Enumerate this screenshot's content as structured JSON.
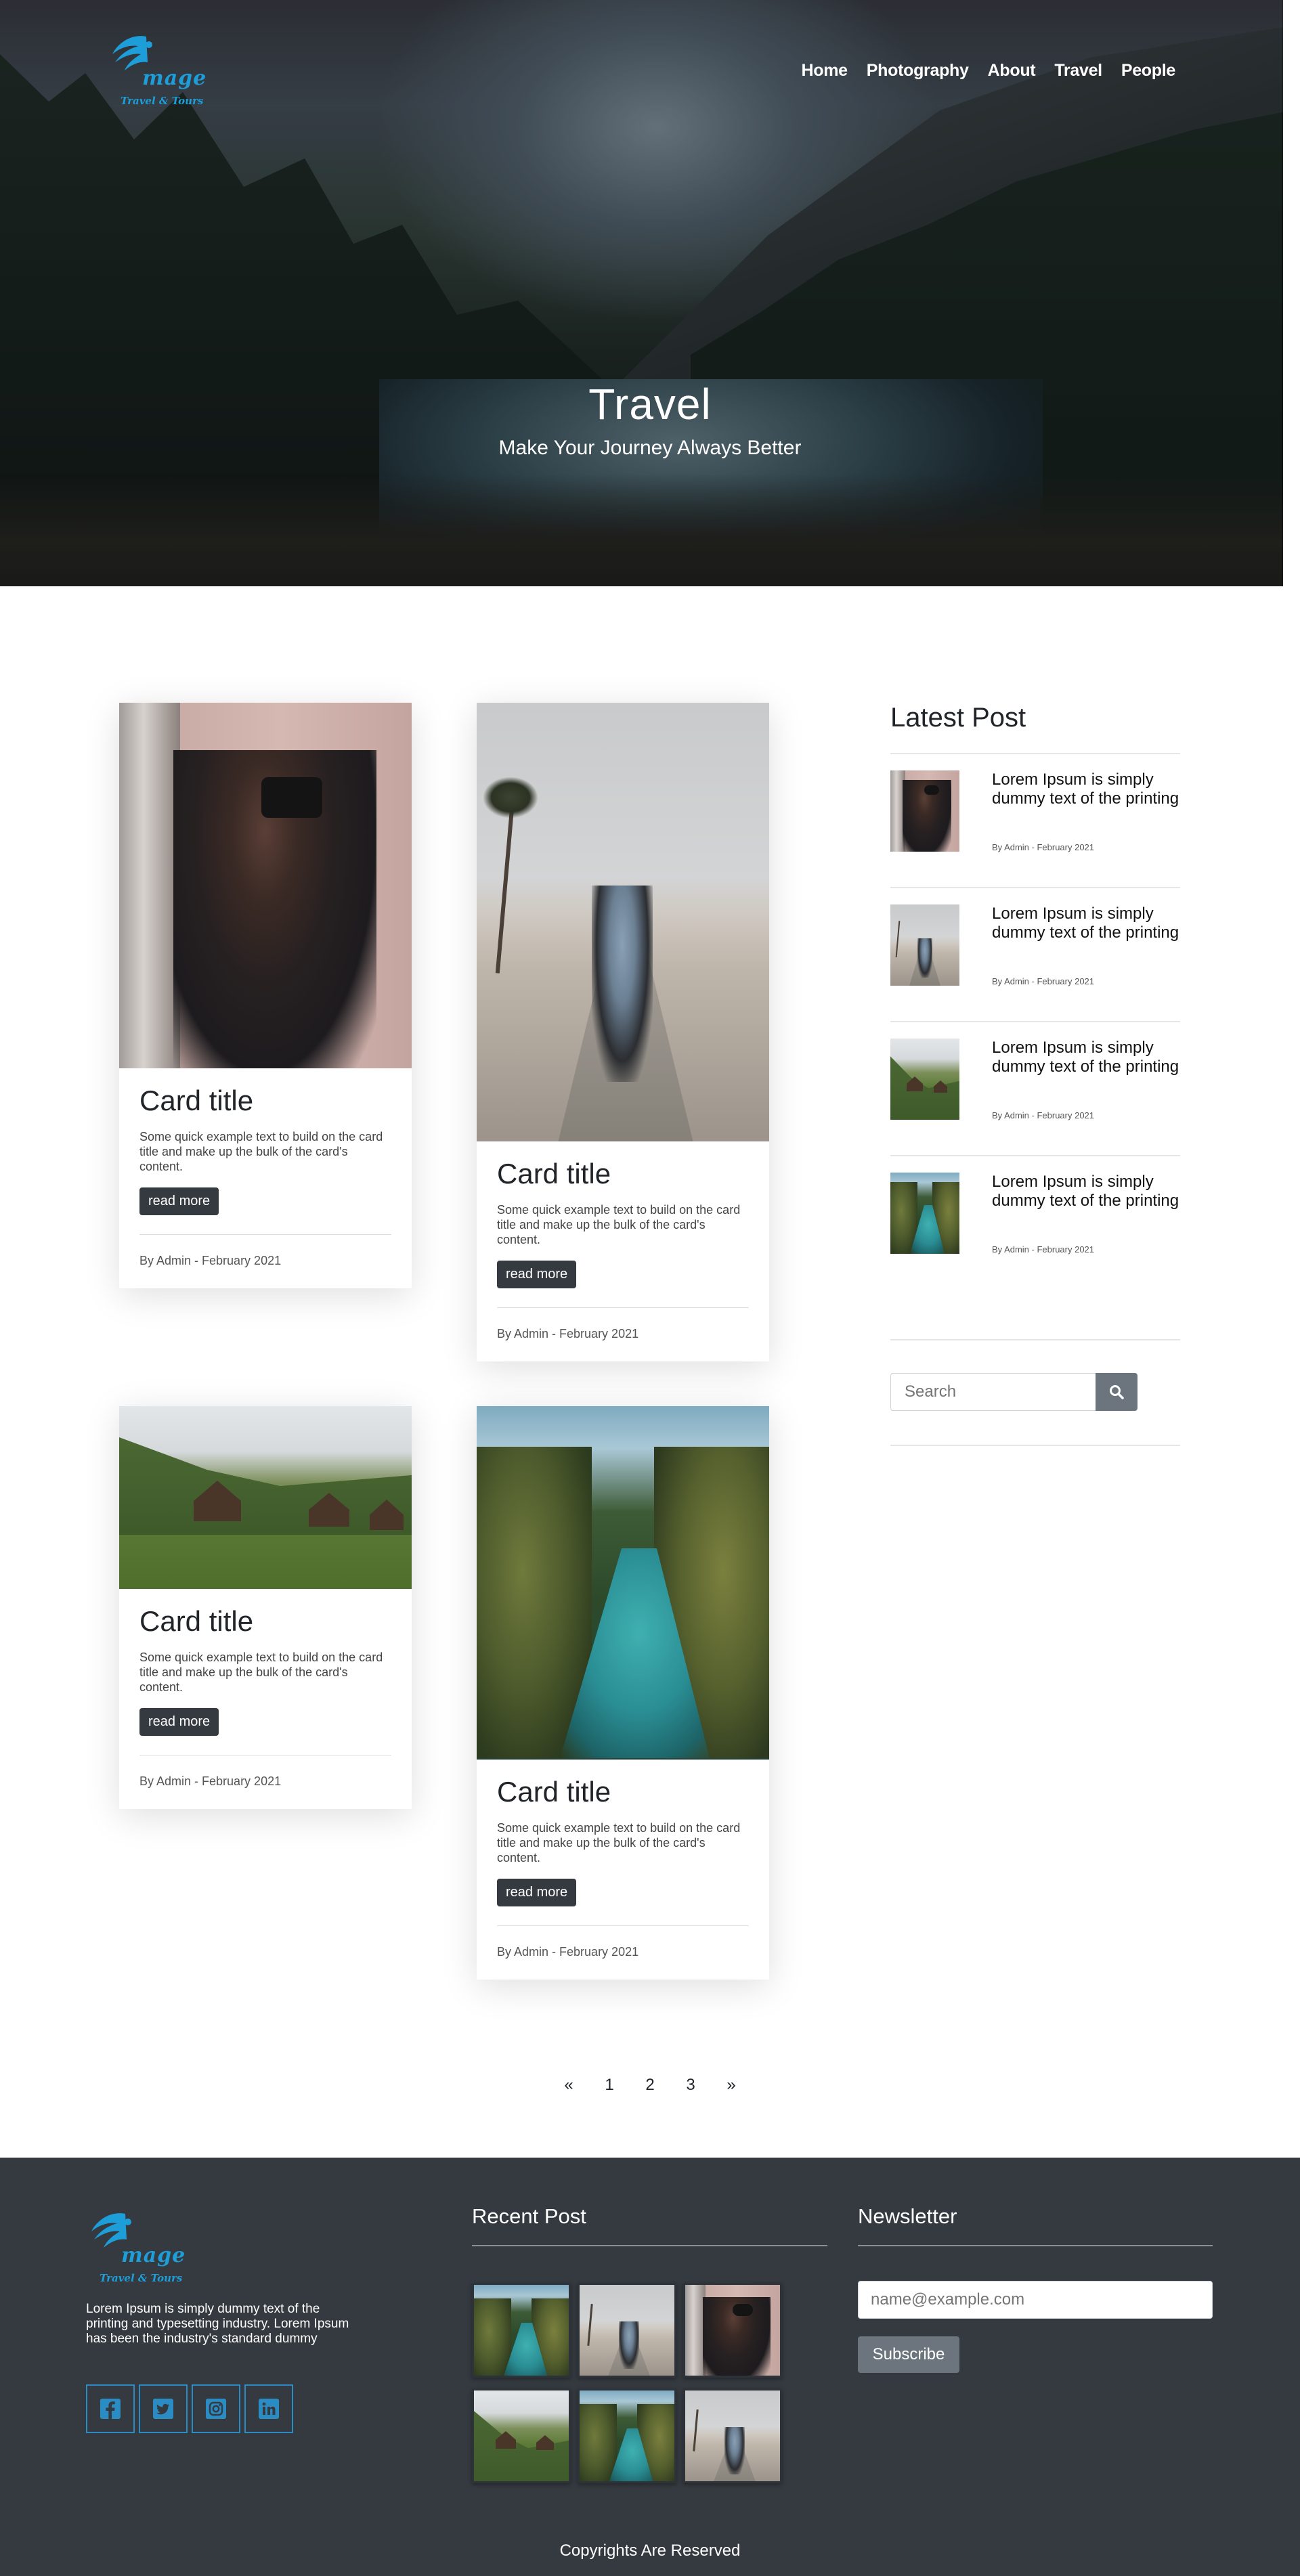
{
  "header": {
    "logo": {
      "name": "mage",
      "tagline": "Travel & Tours"
    },
    "nav": [
      "Home",
      "Photography",
      "About",
      "Travel",
      "People"
    ]
  },
  "hero": {
    "title": "Travel",
    "subtitle": "Make Your Journey Always Better"
  },
  "cards": [
    {
      "image": "photographer-photo",
      "title": "Card title",
      "text": "Some quick example text to build on the card title and make up the bulk of the card's content.",
      "button": "read more",
      "meta": "By Admin - February 2021"
    },
    {
      "image": "skateboarder-photo",
      "title": "Card title",
      "text": "Some quick example text to build on the card title and make up the bulk of the card's content.",
      "button": "read more",
      "meta": "By Admin - February 2021"
    },
    {
      "image": "cabins-photo",
      "title": "Card title",
      "text": "Some quick example text to build on the card title and make up the bulk of the card's content.",
      "button": "read more",
      "meta": "By Admin - February 2021"
    },
    {
      "image": "tropical-river-photo",
      "title": "Card title",
      "text": "Some quick example text to build on the card title and make up the bulk of the card's content.",
      "button": "read more",
      "meta": "By Admin - February 2021"
    }
  ],
  "sidebar": {
    "latest_title": "Latest Post",
    "posts": [
      {
        "image": "photographer-photo",
        "title": "Lorem Ipsum is simply dummy text of the printing",
        "meta": "By Admin - February 2021"
      },
      {
        "image": "skateboarder-photo",
        "title": "Lorem Ipsum is simply dummy text of the printing",
        "meta": "By Admin - February 2021"
      },
      {
        "image": "cabins-photo",
        "title": "Lorem Ipsum is simply dummy text of the printing",
        "meta": "By Admin - February 2021"
      },
      {
        "image": "tropical-river-photo",
        "title": "Lorem Ipsum is simply dummy text of the printing",
        "meta": "By Admin - February 2021"
      }
    ],
    "search": {
      "placeholder": "Search",
      "icon": "search-icon"
    }
  },
  "pagination": {
    "prev": "«",
    "pages": [
      "1",
      "2",
      "3"
    ],
    "next": "»"
  },
  "footer": {
    "about": "Lorem Ipsum is simply dummy text of the printing and typesetting industry. Lorem Ipsum has been the industry's standard dummy",
    "socials": [
      "facebook-icon",
      "twitter-icon",
      "instagram-icon",
      "linkedin-icon"
    ],
    "recent_title": "Recent Post",
    "gallery": [
      "tropical-river-photo",
      "skateboarder-photo",
      "photographer-photo",
      "cabins-photo",
      "tropical-river-photo",
      "skateboarder-photo"
    ],
    "newsletter_title": "Newsletter",
    "newsletter_placeholder": "name@example.com",
    "subscribe": "Subscribe",
    "copyright": "Copyrights Are Reserved"
  },
  "colors": {
    "accent": "#1e9ed8",
    "dark": "#343a40",
    "footer_bg": "#343a40",
    "muted_button": "#6c757d"
  }
}
